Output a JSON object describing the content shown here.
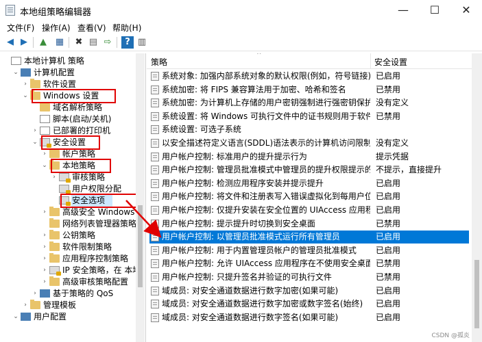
{
  "window": {
    "title": "本地组策略编辑器",
    "minimize": "—",
    "maximize": "☐",
    "close": "✕"
  },
  "menu": [
    "文件(F)",
    "操作(A)",
    "查看(V)",
    "帮助(H)"
  ],
  "toolbar_icons": [
    "back-icon",
    "forward-icon",
    "up-icon",
    "tree-toggle-icon",
    "delete-icon",
    "properties-icon",
    "export-icon",
    "help-icon",
    "view-icon"
  ],
  "tree": [
    {
      "label": "本地计算机 策略",
      "level": 0,
      "exp": "",
      "icon": "doc"
    },
    {
      "label": "计算机配置",
      "level": 1,
      "exp": "v",
      "icon": "pc"
    },
    {
      "label": "软件设置",
      "level": 2,
      "exp": ">",
      "icon": "folder"
    },
    {
      "label": "Windows 设置",
      "level": 2,
      "exp": "v",
      "icon": "folder"
    },
    {
      "label": "域名解析策略",
      "level": 3,
      "exp": "",
      "icon": "folder"
    },
    {
      "label": "脚本(启动/关机)",
      "level": 3,
      "exp": "",
      "icon": "doc"
    },
    {
      "label": "已部署的打印机",
      "level": 3,
      "exp": ">",
      "icon": "doc"
    },
    {
      "label": "安全设置",
      "level": 3,
      "exp": "v",
      "icon": "lock"
    },
    {
      "label": "帐户策略",
      "level": 4,
      "exp": ">",
      "icon": "folder"
    },
    {
      "label": "本地策略",
      "level": 4,
      "exp": "v",
      "icon": "folder"
    },
    {
      "label": "审核策略",
      "level": 5,
      "exp": ">",
      "icon": "lock"
    },
    {
      "label": "用户权限分配",
      "level": 5,
      "exp": "",
      "icon": "lock"
    },
    {
      "label": "安全选项",
      "level": 5,
      "exp": "",
      "icon": "lock"
    },
    {
      "label": "高级安全 Windows",
      "level": 4,
      "exp": ">",
      "icon": "folder"
    },
    {
      "label": "网络列表管理器策略",
      "level": 4,
      "exp": "",
      "icon": "folder"
    },
    {
      "label": "公钥策略",
      "level": 4,
      "exp": ">",
      "icon": "folder"
    },
    {
      "label": "软件限制策略",
      "level": 4,
      "exp": ">",
      "icon": "folder"
    },
    {
      "label": "应用程序控制策略",
      "level": 4,
      "exp": ">",
      "icon": "folder"
    },
    {
      "label": "IP 安全策略，在 本地",
      "level": 4,
      "exp": ">",
      "icon": "lock"
    },
    {
      "label": "高级审核策略配置",
      "level": 4,
      "exp": ">",
      "icon": "folder"
    },
    {
      "label": "基于策略的 QoS",
      "level": 3,
      "exp": ">",
      "icon": "pc"
    },
    {
      "label": "管理模板",
      "level": 2,
      "exp": ">",
      "icon": "folder"
    },
    {
      "label": "用户配置",
      "level": 1,
      "exp": "v",
      "icon": "pc"
    }
  ],
  "table": {
    "col_policy": "策略",
    "col_setting": "安全设置",
    "rows": [
      {
        "name": "系统对象: 加强内部系统对象的默认权限(例如，符号链接)",
        "value": "已启用"
      },
      {
        "name": "系统加密: 将 FIPS 兼容算法用于加密、哈希和签名",
        "value": "已禁用"
      },
      {
        "name": "系统加密: 为计算机上存储的用户密钥强制进行强密钥保护",
        "value": "没有定义"
      },
      {
        "name": "系统设置: 将 Windows 可执行文件中的证书规则用于软件限...",
        "value": "已禁用"
      },
      {
        "name": "系统设置: 可选子系统",
        "value": ""
      },
      {
        "name": "以安全描述符定义语言(SDDL)语法表示的计算机访问限制",
        "value": "没有定义"
      },
      {
        "name": "用户帐户控制: 标准用户的提升提示行为",
        "value": "提示凭据"
      },
      {
        "name": "用户帐户控制: 管理员批准模式中管理员的提升权限提示的...",
        "value": "不提示，直接提升"
      },
      {
        "name": "用户帐户控制: 检测应用程序安装并提示提升",
        "value": "已启用"
      },
      {
        "name": "用户帐户控制: 将文件和注册表写入错误虚拟化到每用户位置",
        "value": "已启用"
      },
      {
        "name": "用户帐户控制: 仅提升安装在安全位置的 UIAccess 应用程序",
        "value": "已启用"
      },
      {
        "name": "用户帐户控制: 提示提升时切换到安全桌面",
        "value": "已禁用"
      },
      {
        "name": "用户帐户控制: 以管理员批准模式运行所有管理员",
        "value": "已启用"
      },
      {
        "name": "用户帐户控制: 用于内置管理员帐户的管理员批准模式",
        "value": "已启用"
      },
      {
        "name": "用户帐户控制: 允许 UIAccess 应用程序在不使用安全桌面的...",
        "value": "已禁用"
      },
      {
        "name": "用户帐户控制: 只提升签名并验证的可执行文件",
        "value": "已禁用"
      },
      {
        "name": "域成员: 对安全通道数据进行数字加密(如果可能)",
        "value": "已启用"
      },
      {
        "name": "域成员: 对安全通道数据进行数字加密或数字签名(始终)",
        "value": "已启用"
      },
      {
        "name": "域成员: 对安全通道数据进行数字签名(如果可能)",
        "value": "已启用"
      }
    ],
    "selected_index": 12
  },
  "colors": {
    "selection": "#0078d7",
    "highlight_box": "#e00000",
    "folder": "#e9c46a"
  },
  "watermark": "CSDN @孤炎"
}
